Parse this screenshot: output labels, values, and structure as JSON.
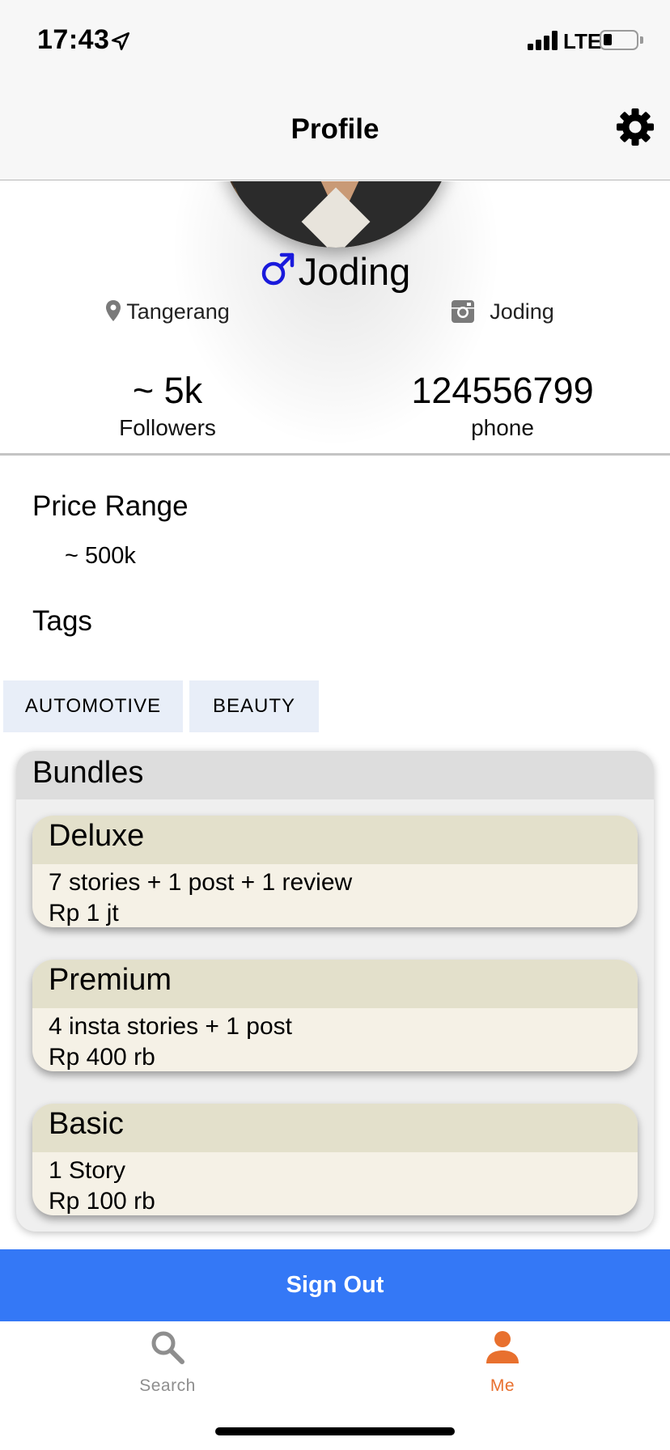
{
  "status_bar": {
    "time": "17:43",
    "network": "LTE",
    "battery_level": 0.25
  },
  "header": {
    "title": "Profile"
  },
  "profile": {
    "name": "Joding",
    "location": "Tangerang",
    "instagram": "Joding",
    "followers_value": "~ 5k",
    "followers_label": "Followers",
    "phone_value": "124556799",
    "phone_label": "phone"
  },
  "price_range": {
    "title": "Price Range",
    "value": "~ 500k"
  },
  "tags": {
    "title": "Tags",
    "items": [
      "AUTOMOTIVE",
      "BEAUTY"
    ]
  },
  "bundles": {
    "title": "Bundles",
    "items": [
      {
        "name": "Deluxe",
        "description": "7 stories + 1 post + 1 review",
        "price": "Rp 1 jt"
      },
      {
        "name": "Premium",
        "description": "4 insta stories + 1 post",
        "price": "Rp 400 rb"
      },
      {
        "name": "Basic",
        "description": "1 Story",
        "price": "Rp 100 rb"
      }
    ]
  },
  "actions": {
    "sign_out": "Sign Out"
  },
  "tabbar": {
    "items": [
      {
        "label": "Search",
        "icon": "search-icon"
      },
      {
        "label": "Me",
        "icon": "person-icon"
      }
    ],
    "active_color": "#e8702e",
    "inactive_color": "#8e8e8e"
  },
  "colors": {
    "accent": "#3478f6",
    "male_icon": "#1a1adc"
  }
}
